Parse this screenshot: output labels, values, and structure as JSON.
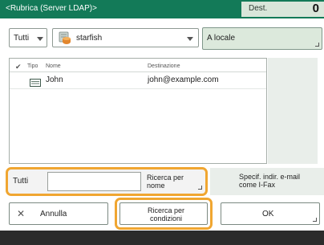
{
  "header": {
    "title": "<Rubrica (Server LDAP)>",
    "dest_label": "Dest.",
    "dest_count": "0"
  },
  "filters": {
    "category_value": "Tutti",
    "server_value": "starfish",
    "to_local_label": "A locale"
  },
  "list": {
    "columns": {
      "check": "✔",
      "type": "Tipo",
      "name": "Nome",
      "destination": "Destinazione"
    },
    "rows": [
      {
        "type_icon": "envelope-icon",
        "name": "John",
        "destination": "john@example.com"
      }
    ]
  },
  "search": {
    "scope_label": "Tutti",
    "query_value": "",
    "search_by_name_label": "Ricerca per nome",
    "ifax_label": "Specif. indir. e-mail come I-Fax"
  },
  "actions": {
    "cancel_label": "Annulla",
    "search_by_conditions_label": "Ricerca per condizioni",
    "ok_label": "OK"
  },
  "colors": {
    "header": "#137a58",
    "highlight": "#f0a631",
    "bottom_bar": "#2b2b2b"
  }
}
